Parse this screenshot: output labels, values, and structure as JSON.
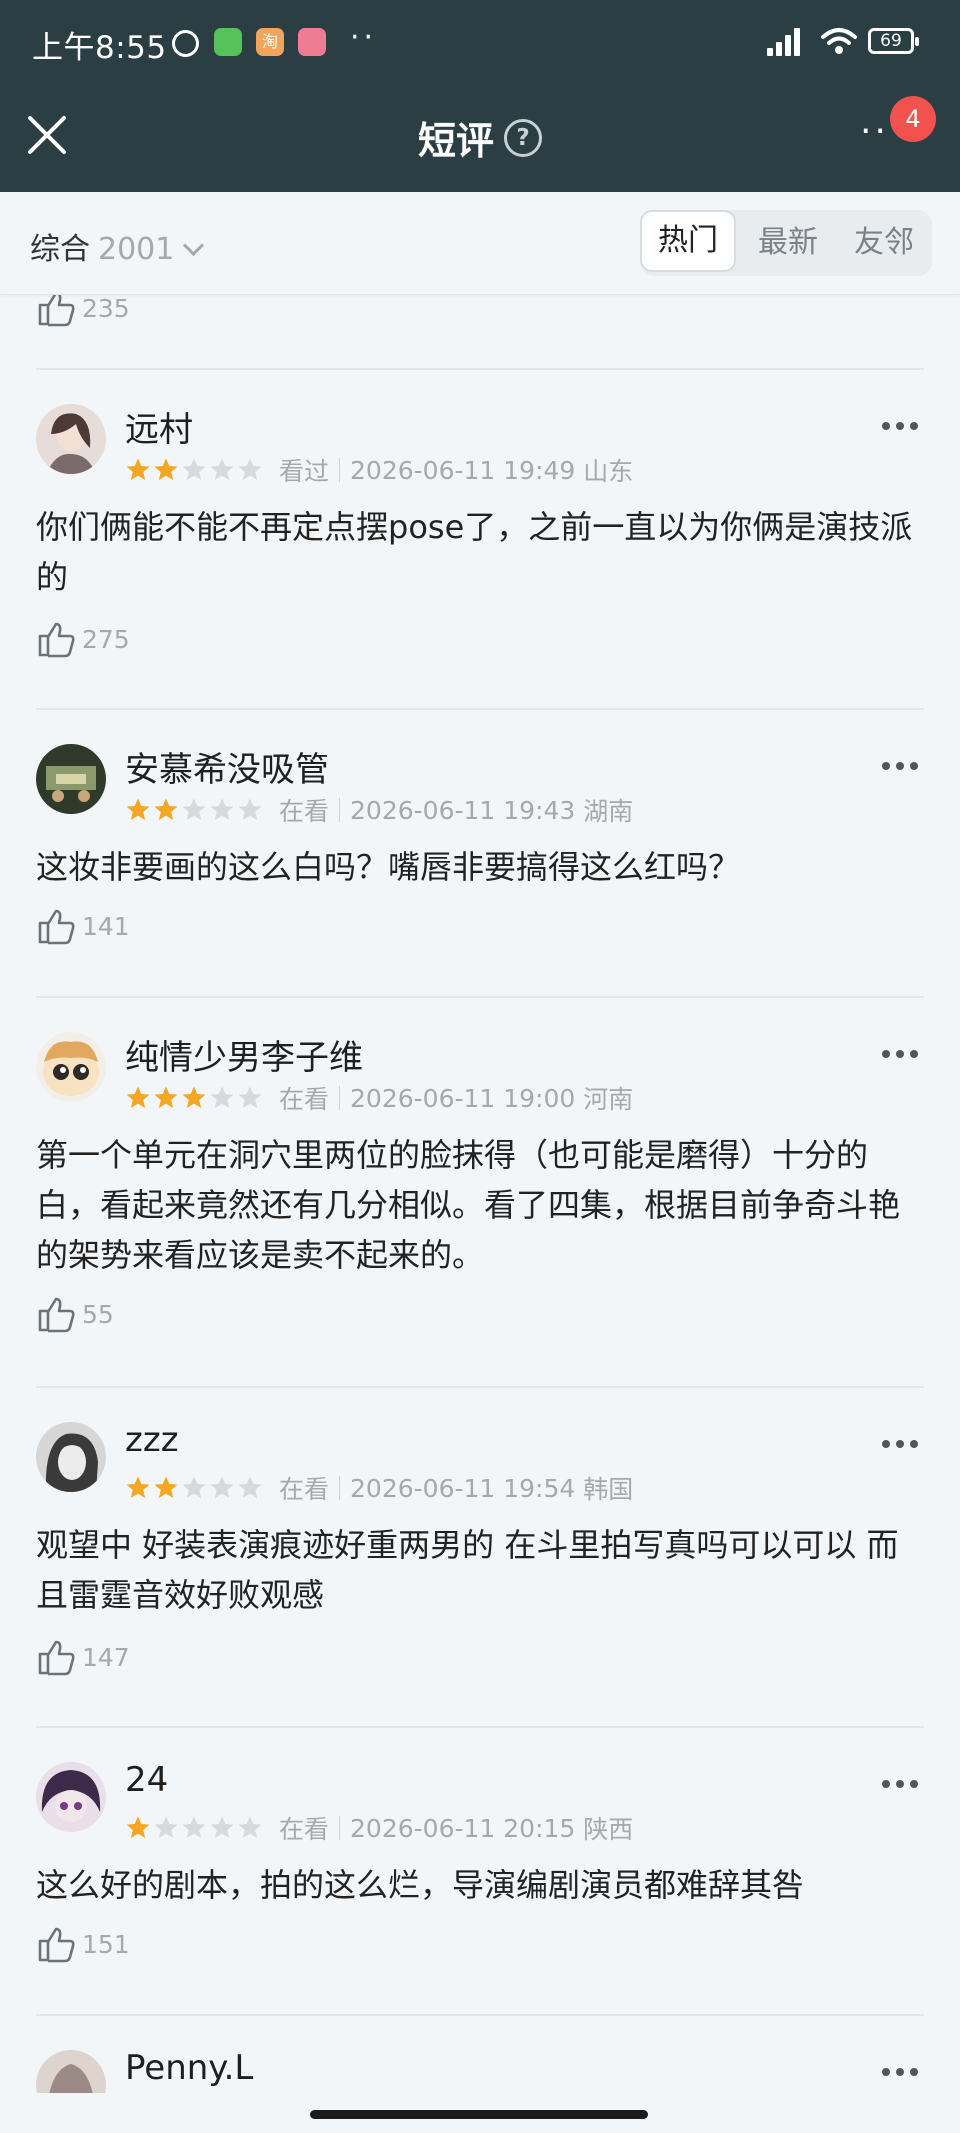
{
  "status_bar": {
    "time": "上午8:55",
    "taobao_glyph": "淘",
    "dots": "··",
    "battery": "69"
  },
  "header": {
    "title": "短评",
    "help_glyph": "?",
    "more_glyph": "··",
    "badge_count": "4",
    "icons": [
      "close-icon",
      "help-icon",
      "more-icon"
    ]
  },
  "filter": {
    "sort_label": "综合",
    "count": "2001",
    "tabs": [
      "热门",
      "最新",
      "友邻"
    ],
    "active_tab": 0
  },
  "top_partial": {
    "likes": "235"
  },
  "comments": [
    {
      "name": "远村",
      "rating": 2,
      "status": "看过",
      "datetime": "2026-06-11 19:49",
      "location": "山东",
      "text": "你们俩能不能不再定点摆pose了，之前一直以为你俩是演技派的",
      "likes": "275",
      "avatar_color": "#c9b8b0"
    },
    {
      "name": "安慕希没吸管",
      "rating": 2,
      "status": "在看",
      "datetime": "2026-06-11 19:43",
      "location": "湖南",
      "text": "这妆非要画的这么白吗？嘴唇非要搞得这么红吗？",
      "likes": "141",
      "avatar_color": "#4a5a3c"
    },
    {
      "name": "纯情少男李子维",
      "rating": 3,
      "status": "在看",
      "datetime": "2026-06-11 19:00",
      "location": "河南",
      "text": "第一个单元在洞穴里两位的脸抹得（也可能是磨得）十分的白，看起来竟然还有几分相似。看了四集，根据目前争奇斗艳的架势来看应该是卖不起来的。",
      "likes": "55",
      "avatar_color": "#e7c79a"
    },
    {
      "name": "zzz",
      "rating": 2,
      "status": "在看",
      "datetime": "2026-06-11 19:54",
      "location": "韩国",
      "text": "观望中 好装表演痕迹好重两男的 在斗里拍写真吗可以可以 而且雷霆音效好败观感",
      "likes": "147",
      "avatar_color": "#8e8e8e"
    },
    {
      "name": "24",
      "rating": 1,
      "status": "在看",
      "datetime": "2026-06-11 20:15",
      "location": "陕西",
      "text": "这么好的剧本，拍的这么烂，导演编剧演员都难辞其咎",
      "likes": "151",
      "avatar_color": "#6f5a7a"
    },
    {
      "name": "Penny.L",
      "avatar_color": "#b9a9a4"
    }
  ],
  "colors": {
    "header_bg": "#2b3e44",
    "page_bg": "#f3f6f8",
    "star_on": "#f5a623",
    "star_off": "#d6dadd",
    "badge": "#f2514e"
  }
}
